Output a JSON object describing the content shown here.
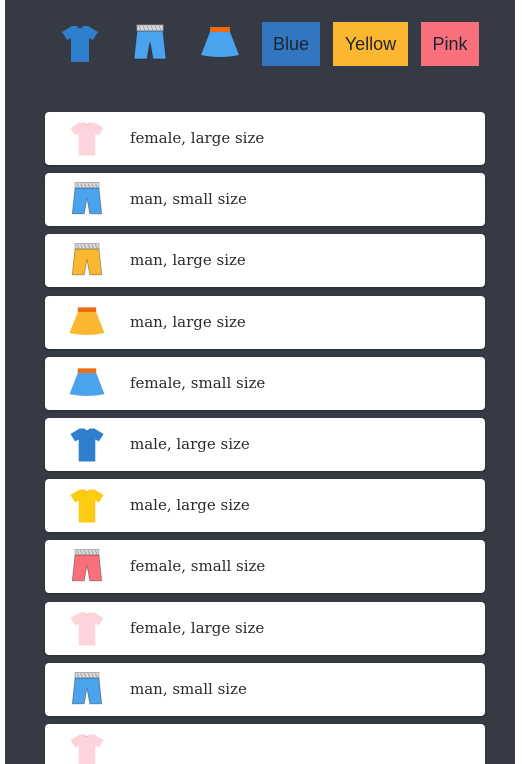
{
  "filters": {
    "icons": [
      {
        "name": "tshirt-filter",
        "icon": "tshirt-icon",
        "color": "#2f7fcf"
      },
      {
        "name": "shorts-filter",
        "icon": "shorts-icon",
        "color": "#4aa3ec"
      },
      {
        "name": "skirt-filter",
        "icon": "skirt-icon",
        "color": "#4aa3ec"
      }
    ],
    "colors": [
      {
        "name": "blue",
        "label": "Blue",
        "color": "#3276bf"
      },
      {
        "name": "yellow",
        "label": "Yellow",
        "color": "#fbb72f"
      },
      {
        "name": "pink",
        "label": "Pink",
        "color": "#f7707b"
      }
    ]
  },
  "items": [
    {
      "icon": "tshirt-icon",
      "color": "#fdd3dc",
      "label": "female, large size"
    },
    {
      "icon": "shorts-icon",
      "color": "#4aa3ec",
      "label": "man, small size"
    },
    {
      "icon": "shorts-icon",
      "color": "#fbb72f",
      "label": "man, large size"
    },
    {
      "icon": "skirt-icon",
      "color": "#fbb72f",
      "label": "man, large size"
    },
    {
      "icon": "skirt-icon",
      "color": "#4aa3ec",
      "label": "female, small size"
    },
    {
      "icon": "tshirt-icon",
      "color": "#2f7fcf",
      "label": "male, large size"
    },
    {
      "icon": "tshirt-icon",
      "color": "#fccb12",
      "label": "male, large size"
    },
    {
      "icon": "shorts-icon",
      "color": "#f7707b",
      "label": "female, small size"
    },
    {
      "icon": "tshirt-icon",
      "color": "#fdd3dc",
      "label": "female, large size"
    },
    {
      "icon": "shorts-icon",
      "color": "#4aa3ec",
      "label": "man, small size"
    },
    {
      "icon": "tshirt-icon",
      "color": "#fdd3dc",
      "label": ""
    }
  ]
}
